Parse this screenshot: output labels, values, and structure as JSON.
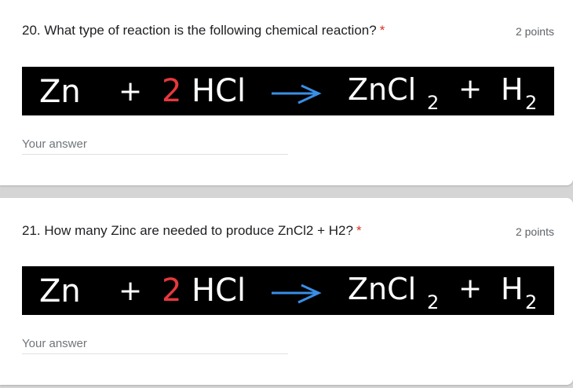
{
  "questions": [
    {
      "title": "20. What type of reaction is the following chemical reaction?",
      "required_mark": "*",
      "points": "2 points",
      "answer_placeholder": "Your answer",
      "equation": {
        "zn": "Zn",
        "plus1": "+",
        "coef": "2",
        "hcl": "HCl",
        "zncl": "ZnCl",
        "sub2a": "2",
        "plus2": "+",
        "h": "H",
        "sub2b": "2"
      }
    },
    {
      "title": "21. How many Zinc are needed to produce ZnCl2 + H2?",
      "required_mark": "*",
      "points": "2 points",
      "answer_placeholder": "Your answer",
      "equation": {
        "zn": "Zn",
        "plus1": "+",
        "coef": "2",
        "hcl": "HCl",
        "zncl": "ZnCl",
        "sub2a": "2",
        "plus2": "+",
        "h": "H",
        "sub2b": "2"
      }
    }
  ],
  "colors": {
    "required": "#d93025",
    "coefficient": "#e8383d",
    "arrow": "#3a8ee6",
    "equation_bg": "#000000"
  }
}
